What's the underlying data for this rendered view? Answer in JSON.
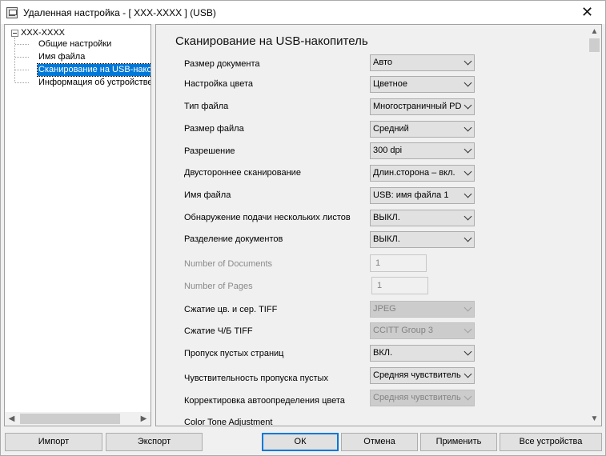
{
  "window": {
    "title": "Удаленная настройка - [ XXX-XXXX ] (USB)",
    "close_glyph": "✕"
  },
  "tree": {
    "root": "XXX-XXXX",
    "items": [
      {
        "label": "Общие настройки"
      },
      {
        "label": "Имя файла"
      },
      {
        "label": "Сканирование на USB-нако"
      },
      {
        "label": "Информация об устройстве"
      }
    ],
    "selected_index": 2
  },
  "main": {
    "heading": "Сканирование на USB-накопитель",
    "rows": [
      {
        "label": "Размер документа",
        "value": "Авто",
        "type": "select",
        "enabled": true
      },
      {
        "label": "Настройка цвета",
        "value": "Цветное",
        "type": "select",
        "enabled": true
      },
      {
        "label": "Тип файла",
        "value": "Многостраничный PD",
        "type": "select",
        "enabled": true
      },
      {
        "label": "Размер файла",
        "value": "Средний",
        "type": "select",
        "enabled": true
      },
      {
        "label": "Разрешение",
        "value": "300 dpi",
        "type": "select",
        "enabled": true
      },
      {
        "label": "Двустороннее сканирование",
        "value": "Длин.сторона – вкл.",
        "type": "select",
        "enabled": true
      },
      {
        "label": "Имя файла",
        "value": "USB: имя файла 1",
        "type": "select",
        "enabled": true
      },
      {
        "label": "Обнаружение подачи нескольких листов",
        "value": "ВЫКЛ.",
        "type": "select",
        "enabled": true
      },
      {
        "label": "Разделение документов",
        "value": "ВЫКЛ.",
        "type": "select",
        "enabled": true
      },
      {
        "label": "Number of Documents",
        "value": "1",
        "type": "number",
        "enabled": false
      },
      {
        "label": "Number of Pages",
        "value": "1",
        "type": "number",
        "enabled": false
      },
      {
        "label": "Сжатие цв. и сер. TIFF",
        "value": "JPEG",
        "type": "select",
        "enabled": false
      },
      {
        "label": "Сжатие Ч/Б TIFF",
        "value": "CCITT Group 3",
        "type": "select",
        "enabled": false
      },
      {
        "label": "Пропуск пустых страниц",
        "value": "ВКЛ.",
        "type": "select",
        "enabled": true
      },
      {
        "label": "Чувствительность пропуска пустых",
        "value": "Средняя чувствительн",
        "type": "select",
        "enabled": true
      },
      {
        "label": "Корректировка автоопределения цвета",
        "value": "Средняя чувствительн",
        "type": "select",
        "enabled": false
      },
      {
        "label": "Color Tone Adjustment",
        "value": "",
        "type": "label",
        "enabled": true
      }
    ]
  },
  "buttons": {
    "import": "Импорт",
    "export": "Экспорт",
    "ok": "ОК",
    "cancel": "Отмена",
    "apply": "Применить",
    "all_devices": "Все устройства"
  },
  "icons": {
    "scroll_up": "▲",
    "scroll_down": "▼",
    "scroll_left": "◀",
    "scroll_right": "▶"
  }
}
